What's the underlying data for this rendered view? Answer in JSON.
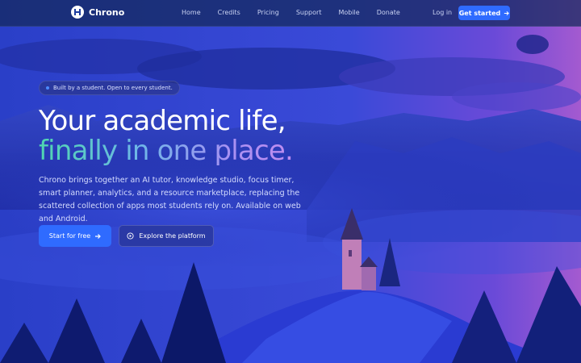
{
  "nav": {
    "brand": "Chrono",
    "links": [
      "Home",
      "Credits",
      "Pricing",
      "Support",
      "Mobile",
      "Donate"
    ],
    "login": "Log in",
    "cta": "Get started"
  },
  "hero": {
    "badge": "Built by a student. Open to every student.",
    "title_line1": "Your academic life,",
    "title_line2": "finally in one place.",
    "description": "Chrono brings together an AI tutor, knowledge studio, focus timer, smart planner, analytics, and a resource marketplace, replacing the scattered collection of apps most students rely on. Available on web and Android.",
    "primary_button": "Start for free",
    "secondary_button": "Explore the platform"
  },
  "icons": {
    "brand": "chrono-logo-icon",
    "cta_arrow": "arrow-right-icon",
    "primary_arrow": "arrow-right-icon",
    "secondary": "play-circle-icon"
  },
  "colors": {
    "accent": "#2f6bff",
    "background": "#2436c8",
    "nav_background": "#142a5a",
    "gradient_start": "#4fd6b0",
    "gradient_end": "#c08cf0"
  }
}
